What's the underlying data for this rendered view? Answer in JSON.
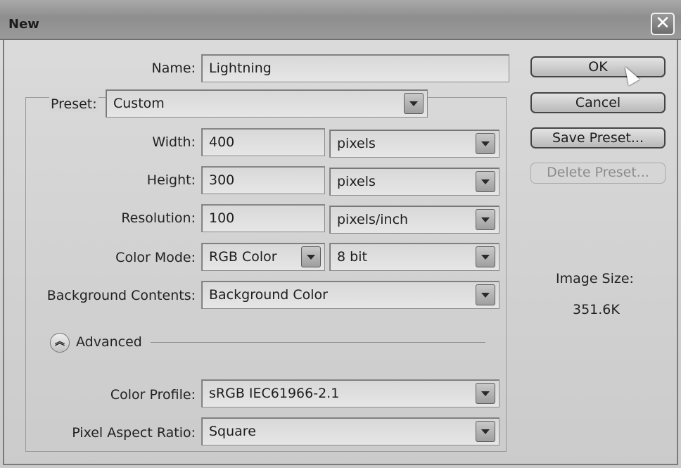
{
  "window": {
    "title": "New"
  },
  "form": {
    "name": {
      "label": "Name:",
      "value": "Lightning"
    },
    "preset": {
      "label": "Preset:",
      "value": "Custom"
    },
    "width": {
      "label": "Width:",
      "value": "400",
      "unit": "pixels"
    },
    "height": {
      "label": "Height:",
      "value": "300",
      "unit": "pixels"
    },
    "resolution": {
      "label": "Resolution:",
      "value": "100",
      "unit": "pixels/inch"
    },
    "color_mode": {
      "label": "Color Mode:",
      "value": "RGB Color",
      "depth": "8 bit"
    },
    "background": {
      "label": "Background Contents:",
      "value": "Background Color"
    },
    "advanced": {
      "label": "Advanced"
    },
    "color_profile": {
      "label": "Color Profile:",
      "value": "sRGB IEC61966-2.1"
    },
    "pixel_aspect": {
      "label": "Pixel Aspect Ratio:",
      "value": "Square"
    }
  },
  "buttons": {
    "ok": "OK",
    "cancel": "Cancel",
    "save_preset": "Save Preset...",
    "delete_preset": "Delete Preset..."
  },
  "image_size": {
    "label": "Image Size:",
    "value": "351.6K"
  },
  "icons": {
    "close": "close-icon",
    "dropdown": "chevron-down-icon",
    "advanced": "double-chevron-up-icon"
  }
}
